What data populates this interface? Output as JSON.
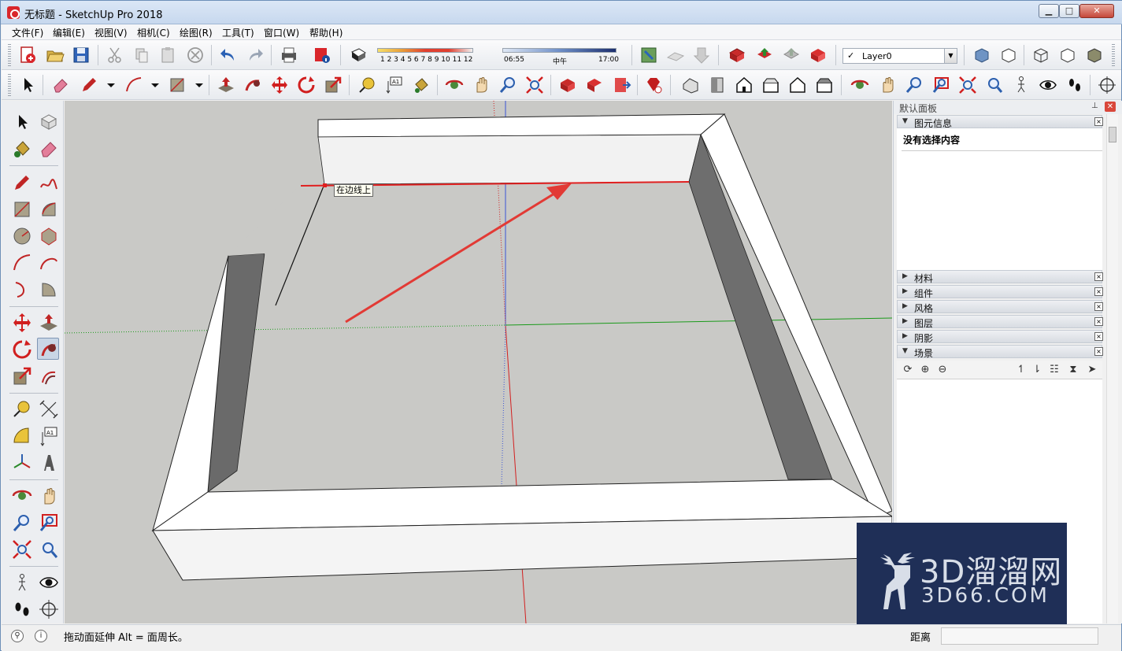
{
  "window": {
    "title": "无标题 - SketchUp Pro 2018",
    "minimize": "▁",
    "maximize": "□",
    "close": "✕"
  },
  "menu": [
    "文件(F)",
    "编辑(E)",
    "视图(V)",
    "相机(C)",
    "绘图(R)",
    "工具(T)",
    "窗口(W)",
    "帮助(H)"
  ],
  "shadow": {
    "month_ticks": "1 2 3 4 5 6 7 8 9 10 11 12",
    "time_start": "06:55",
    "time_mid": "中午",
    "time_end": "17:00"
  },
  "layer": {
    "checkmark": "✓",
    "current": "Layer0"
  },
  "viewport": {
    "inference_tooltip": "在边线上"
  },
  "panel": {
    "title": "默认面板",
    "pin": "⊥",
    "close": "✕",
    "entity_info": {
      "label": "图元信息",
      "toggle": "▼",
      "message": "没有选择内容"
    },
    "trays": [
      {
        "label": "材料",
        "toggle": "▶"
      },
      {
        "label": "组件",
        "toggle": "▶"
      },
      {
        "label": "风格",
        "toggle": "▶"
      },
      {
        "label": "图层",
        "toggle": "▶"
      },
      {
        "label": "阴影",
        "toggle": "▶"
      },
      {
        "label": "场景",
        "toggle": "▼"
      }
    ],
    "tray_close": "×"
  },
  "statusbar": {
    "message": "拖动面延伸  Alt = 面周长。",
    "measurement_label": "距离",
    "measurement_value": ""
  },
  "watermark": {
    "line1": "3D溜溜网",
    "line2": "3D66.COM"
  },
  "colors": {
    "accent_red": "#e23a35",
    "axis_red": "#d22020",
    "axis_green": "#1a9a1a",
    "axis_blue": "#3b55d6",
    "viewport_bg": "#c9c9c6"
  }
}
